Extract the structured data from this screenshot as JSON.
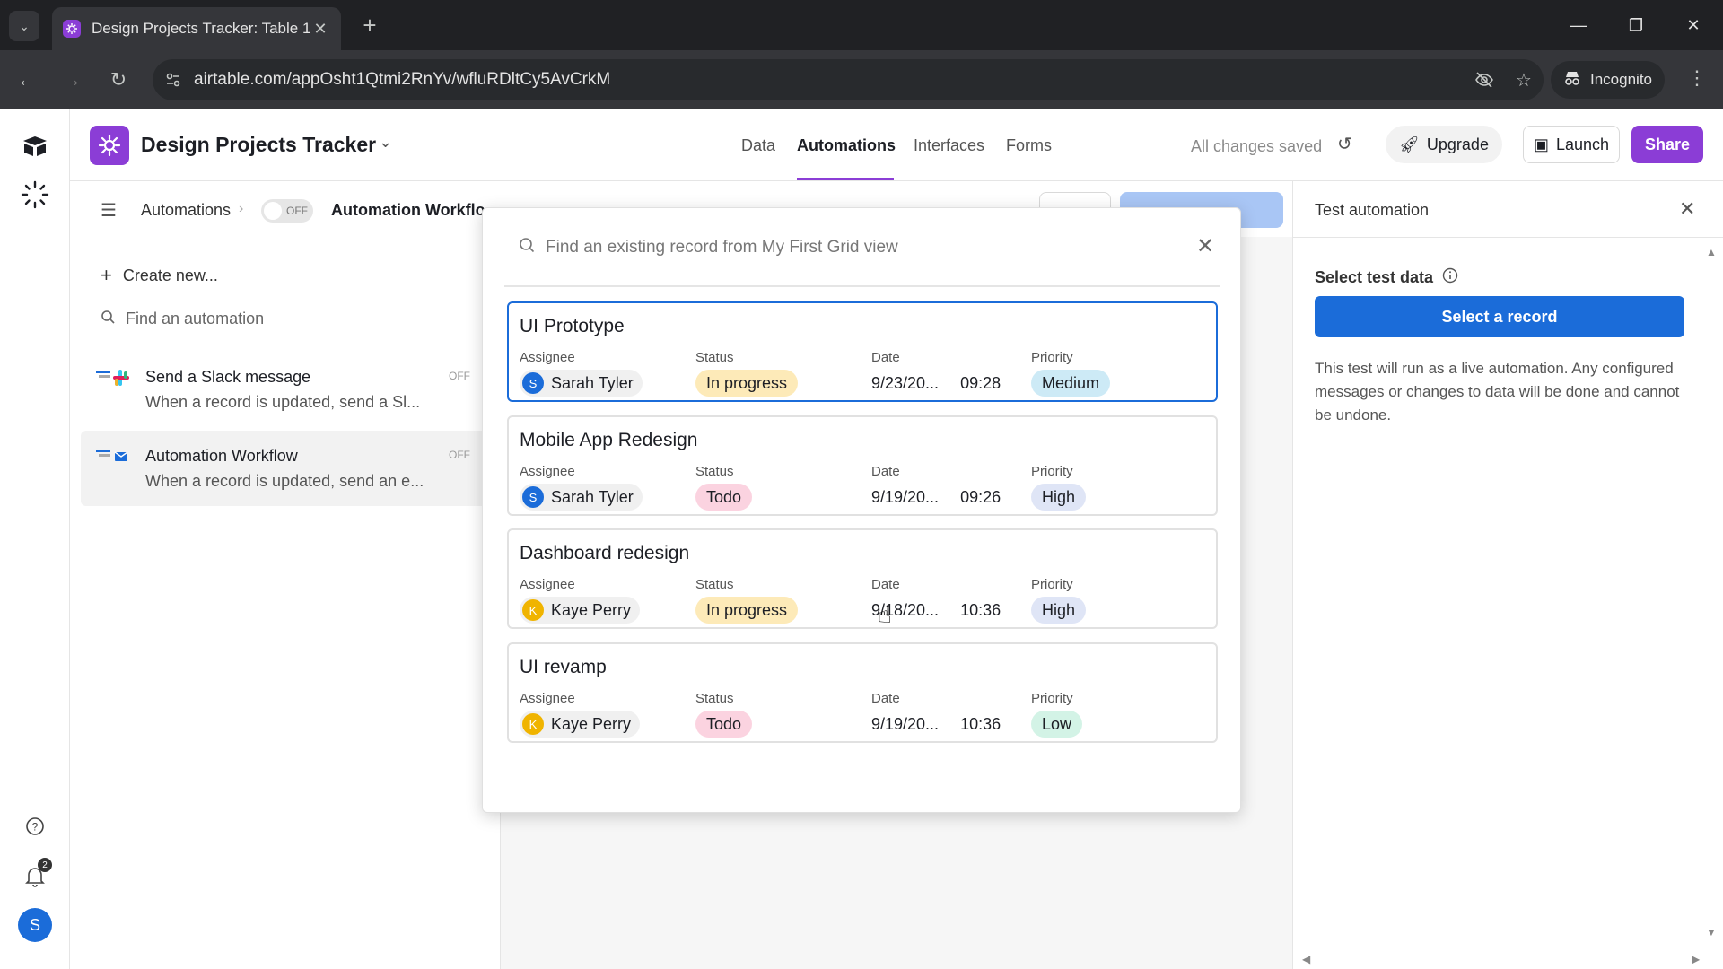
{
  "browser": {
    "tab_title": "Design Projects Tracker: Table 1",
    "url": "airtable.com/appOsht1Qtmi2RnYv/wfluRDltCy5AvCrkM",
    "profile": "Incognito"
  },
  "header": {
    "base_name": "Design Projects Tracker",
    "nav": [
      "Data",
      "Automations",
      "Interfaces",
      "Forms"
    ],
    "active_nav": "Automations",
    "saved_status": "All changes saved",
    "upgrade_label": "Upgrade",
    "launch_label": "Launch",
    "share_label": "Share"
  },
  "subheader": {
    "crumb_root": "Automations",
    "toggle_label": "OFF",
    "crumb_current": "Automation Workflo"
  },
  "sidebar": {
    "create_label": "Create new...",
    "search_placeholder": "Find an automation",
    "items": [
      {
        "name": "Send a Slack message",
        "desc": "When a record is updated, send a Sl...",
        "state": "OFF"
      },
      {
        "name": "Automation Workflow",
        "desc": "When a record is updated, send an e...",
        "state": "OFF"
      }
    ]
  },
  "rail": {
    "notification_count": "2",
    "user_initial": "S"
  },
  "test_panel": {
    "title": "Test automation",
    "select_label": "Select test data",
    "button_label": "Select a record",
    "note": "This test will run as a live automation. Any configured messages or changes to data will be done and cannot be undone."
  },
  "picker": {
    "search_placeholder": "Find an existing record from My First Grid view",
    "field_labels": {
      "assignee": "Assignee",
      "status": "Status",
      "date": "Date",
      "priority": "Priority"
    },
    "records": [
      {
        "title": "UI Prototype",
        "assignee": "Sarah Tyler",
        "initial": "S",
        "avatar_color": "#1b6cd9",
        "status": "In progress",
        "status_color": "#fdeab8",
        "date": "9/23/20...",
        "time": "09:28",
        "priority": "Medium",
        "priority_color": "#cdeaf6"
      },
      {
        "title": "Mobile App Redesign",
        "assignee": "Sarah Tyler",
        "initial": "S",
        "avatar_color": "#1b6cd9",
        "status": "Todo",
        "status_color": "#fbd3e0",
        "date": "9/19/20...",
        "time": "09:26",
        "priority": "High",
        "priority_color": "#dfe5f6"
      },
      {
        "title": "Dashboard redesign",
        "assignee": "Kaye Perry",
        "initial": "K",
        "avatar_color": "#f0b400",
        "status": "In progress",
        "status_color": "#fdeab8",
        "date": "9/18/20...",
        "time": "10:36",
        "priority": "High",
        "priority_color": "#dfe5f6"
      },
      {
        "title": "UI revamp",
        "assignee": "Kaye Perry",
        "initial": "K",
        "avatar_color": "#f0b400",
        "status": "Todo",
        "status_color": "#fbd3e0",
        "date": "9/19/20...",
        "time": "10:36",
        "priority": "Low",
        "priority_color": "#d3f3e6"
      }
    ]
  }
}
